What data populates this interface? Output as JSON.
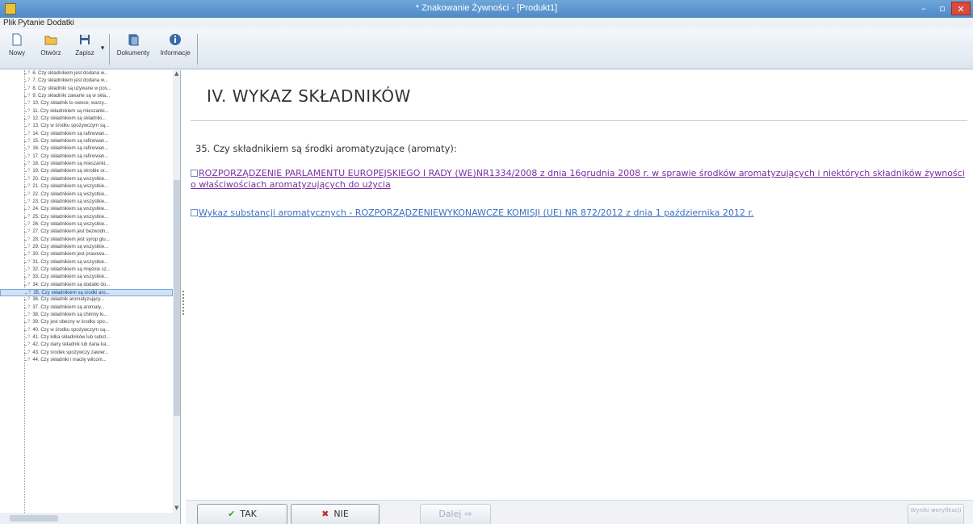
{
  "window": {
    "title": "* Znakowanie Żywności - [Produkt1]",
    "minimize_label": "–",
    "maximize_label": "▫",
    "close_label": "✕"
  },
  "menu": [
    "Plik",
    "Pytanie",
    "Dodatki"
  ],
  "toolbar": {
    "new_label": "Nowy",
    "open_label": "Otwórz",
    "save_label": "Zapisz",
    "documents_label": "Dokumenty",
    "info_label": "Informacje"
  },
  "tree": {
    "items": [
      "6. Czy składnikiem jest dodana w...",
      "7. Czy składnikiem jest dodana w...",
      "8. Czy składniki są używane w pos...",
      "9. Czy składniki zawarte są w skła...",
      "10. Czy składnik to owoce, warzy...",
      "11. Czy składnikiem są mieszanki...",
      "12. Czy składnikiem są składniki...",
      "13. Czy w środku spożywczym są...",
      "14. Czy składnikiem są rafinowan...",
      "15. Czy składnikiem są rafinowan...",
      "16. Czy składnikiem są rafinowan...",
      "17. Czy składnikiem są rafinowan...",
      "18. Czy składnikiem są mieszanki...",
      "19. Czy składnikiem są skrobie or...",
      "20. Czy składnikiem są wszystkie...",
      "21. Czy składnikiem są wszystkie...",
      "22. Czy składnikiem są wszystkie...",
      "23. Czy składnikiem są wszystkie...",
      "24. Czy składnikiem są wszystkie...",
      "25. Czy składnikiem są wszystkie...",
      "26. Czy składnikiem są wszystkie...",
      "27. Czy składnikiem jest bezwodn...",
      "28. Czy składnikiem jest syrop glu...",
      "29. Czy składnikiem są wszystkie...",
      "30. Czy składnikiem jest prasowa...",
      "31. Czy składnikiem są wszystkie...",
      "32. Czy składnikiem są mięśnie sz...",
      "33. Czy składnikiem są wszystkie...",
      "34. Czy składnikiem są dodatki do...",
      "35. Czy składnikiem są środki aro...",
      "36. Czy składnik aromatyzujący...",
      "37. Czy składnikiem są aromaty...",
      "38. Czy składnikiem są chininy lu...",
      "39. Czy jest obecny w środku spo...",
      "40. Czy w środku spożywczym są...",
      "41. Czy kilka składników lub subst...",
      "42. Czy dany składnik lub dana ka...",
      "43. Czy środek spożywczy zawier...",
      "44. Czy składniki i inacily wilcom..."
    ],
    "selected_index": 29,
    "item_prefix": "?"
  },
  "content": {
    "section_title": "IV. WYKAZ SKŁADNIKÓW",
    "question": "35.  Czy składnikiem są środki aromatyzujące (aromaty):",
    "link1": "ROZPORZĄDZENIE PARLAMENTU EUROPEJSKIEGO I RADY (WE)NR1334/2008 z dnia 16grudnia 2008 r. w sprawie środków aromatyzujących i niektórych składników żywności o właściwościach aromatyzujących do użycia",
    "link2": "Wykaz substancji aromatycznych - ROZPORZĄDZENIEWYKONAWCZE KOMISJI (UE) NR 872/2012 z dnia 1 października 2012 r."
  },
  "buttons": {
    "yes_label": "TAK",
    "no_label": "NIE",
    "next_label": "Dalej",
    "right_label": "Wyniki weryfikacji"
  },
  "colors": {
    "visited_link": "#7a2ea3",
    "link": "#3a6fc2",
    "titlebar": "#5b94cf",
    "close": "#d94a3c"
  }
}
